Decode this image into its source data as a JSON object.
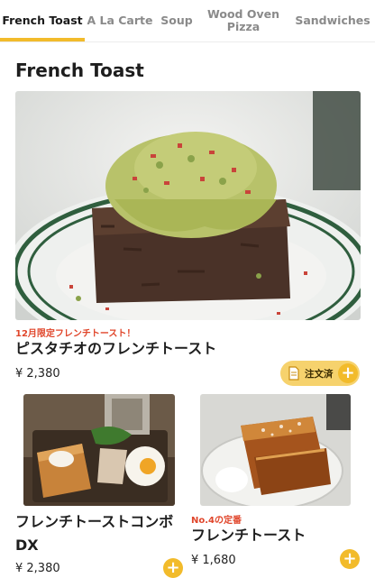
{
  "tabs": [
    {
      "label": "French Toast",
      "active": true
    },
    {
      "label": "A La Carte",
      "active": false
    },
    {
      "label": "Soup",
      "active": false
    },
    {
      "label": "Wood Oven Pizza",
      "active": false
    },
    {
      "label": "Sandwiches",
      "active": false
    }
  ],
  "section": {
    "title": "French Toast"
  },
  "featured": {
    "tag": "12月限定フレンチトースト！",
    "name": "ピスタチオのフレンチトースト",
    "price": "¥ 2,380",
    "order_label": "注文済",
    "order_icon": "document-icon",
    "add_icon": "plus-icon"
  },
  "items": [
    {
      "tag": "",
      "name": "フレンチトーストコンボDX",
      "price": "¥ 2,380"
    },
    {
      "tag": "No.4の定番",
      "name": "フレンチトースト",
      "price": "¥ 1,680"
    }
  ],
  "colors": {
    "accent": "#f2bb2b",
    "tag": "#e0462b",
    "order_pill": "#f6d26d"
  }
}
